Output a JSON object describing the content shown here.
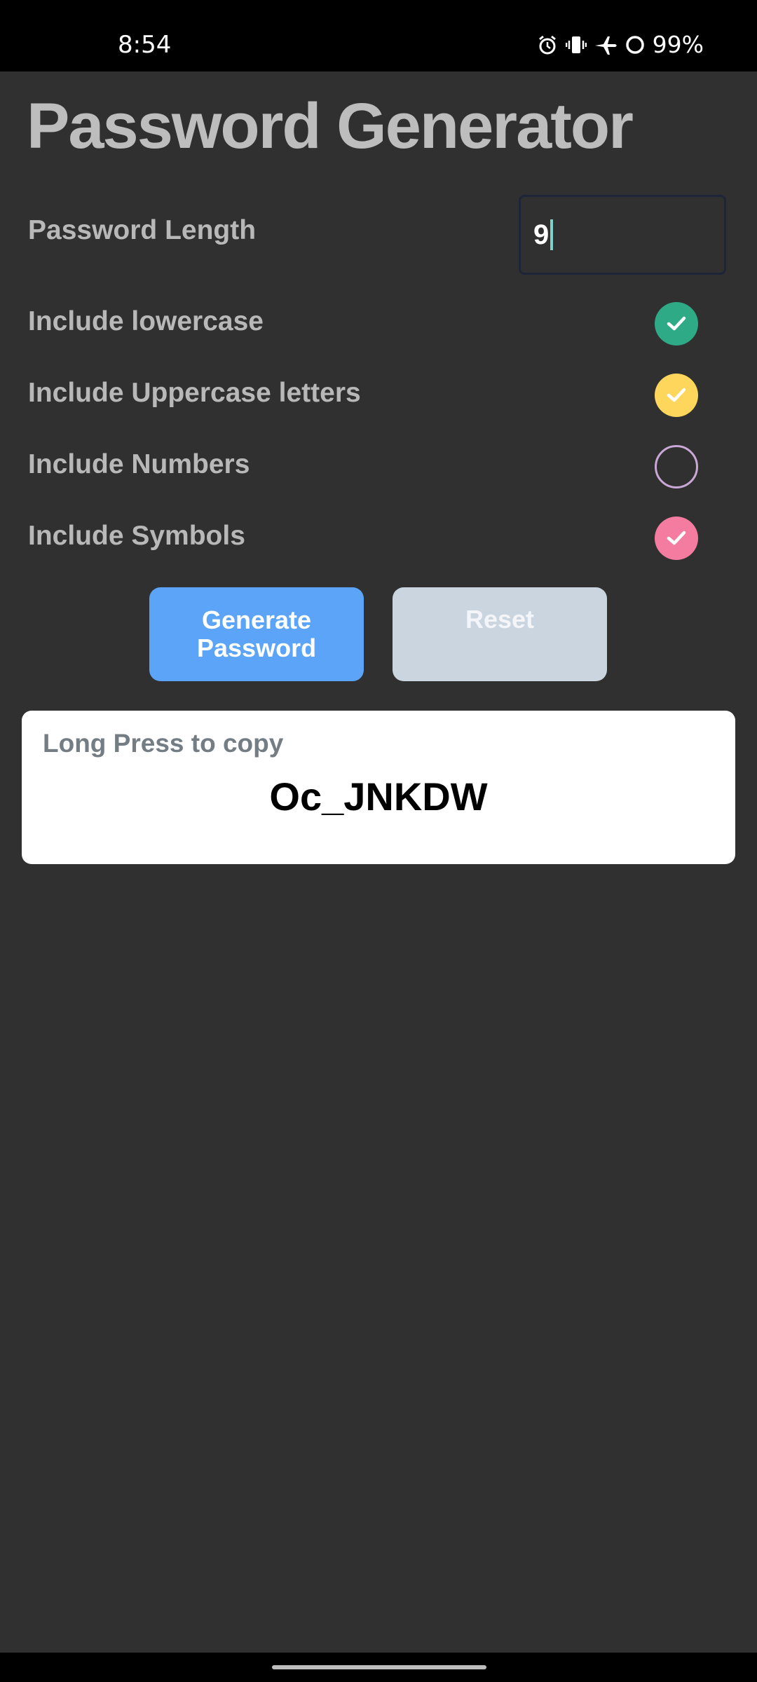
{
  "status_bar": {
    "time": "8:54",
    "battery": "99%",
    "icons": [
      "alarm-icon",
      "vibrate-icon",
      "airplane-icon",
      "data-saver-icon"
    ]
  },
  "title": "Password Generator",
  "length": {
    "label": "Password Length",
    "value": "9"
  },
  "options": [
    {
      "label": "Include lowercase",
      "checked": true,
      "color": "#2eaa87"
    },
    {
      "label": "Include Uppercase letters",
      "checked": true,
      "color": "#ffd65c"
    },
    {
      "label": "Include Numbers",
      "checked": false,
      "color": "#c9a7d6"
    },
    {
      "label": "Include Symbols",
      "checked": true,
      "color": "#f47ca0"
    }
  ],
  "buttons": {
    "generate": "Generate Password",
    "reset": "Reset"
  },
  "result": {
    "hint": "Long Press to copy",
    "password": "Oc_JNKDW"
  },
  "colors": {
    "background": "#303030",
    "generate_button": "#5ba4f7",
    "reset_button": "#cbd5e0"
  }
}
